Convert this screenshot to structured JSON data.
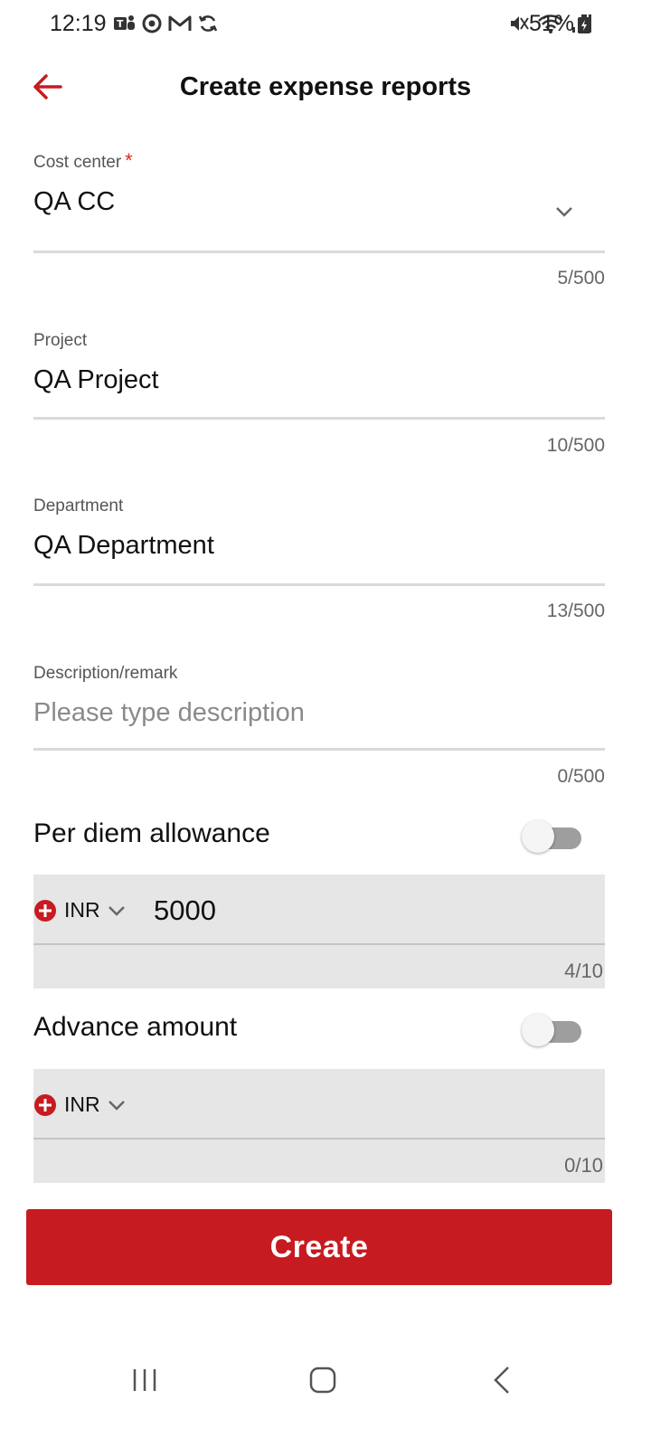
{
  "status_bar": {
    "time": "12:19",
    "battery": "51%",
    "left_icons": [
      "teams-icon",
      "assistant-icon",
      "gmail-icon",
      "sync-icon"
    ],
    "right_icons": [
      "mute-icon",
      "wifi-icon",
      "signal-icon",
      "battery-icon"
    ]
  },
  "header": {
    "title": "Create expense reports",
    "back_icon": "arrow-left-icon",
    "accent_color": "#c61b20"
  },
  "form": {
    "cost_center": {
      "label": "Cost center",
      "required_mark": "*",
      "value": "QA CC",
      "counter": "5/500"
    },
    "project": {
      "label": "Project",
      "value": "QA Project",
      "counter": "10/500"
    },
    "department": {
      "label": "Department",
      "value": "QA Department",
      "counter": "13/500"
    },
    "description": {
      "label": "Description/remark",
      "placeholder": "Please type description",
      "counter": "0/500"
    },
    "per_diem": {
      "label": "Per diem allowance",
      "enabled": false,
      "currency": "INR",
      "amount": "5000",
      "counter": "4/10"
    },
    "advance": {
      "label": "Advance amount",
      "enabled": false,
      "currency": "INR",
      "amount": "",
      "counter": "0/10"
    }
  },
  "actions": {
    "create_label": "Create"
  },
  "nav_bar": {
    "icons": [
      "recent-apps-icon",
      "home-icon",
      "back-icon"
    ]
  }
}
